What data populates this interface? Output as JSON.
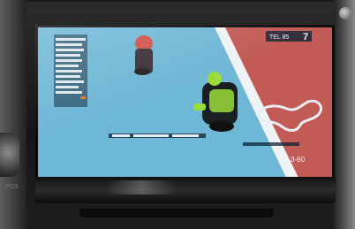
{
  "scene": {
    "subject": "in-car head unit screen showing motorcycle race broadcast"
  },
  "broadcast": {
    "position_tag": "7",
    "position_prefix": "TEL 85",
    "channel_logo": "3-60"
  },
  "colors": {
    "track_blue": "#6fb7d6",
    "kerb_red": "#c25a55",
    "bike_green": "#9bdc3a",
    "hud_text": "#f2f6fa"
  }
}
